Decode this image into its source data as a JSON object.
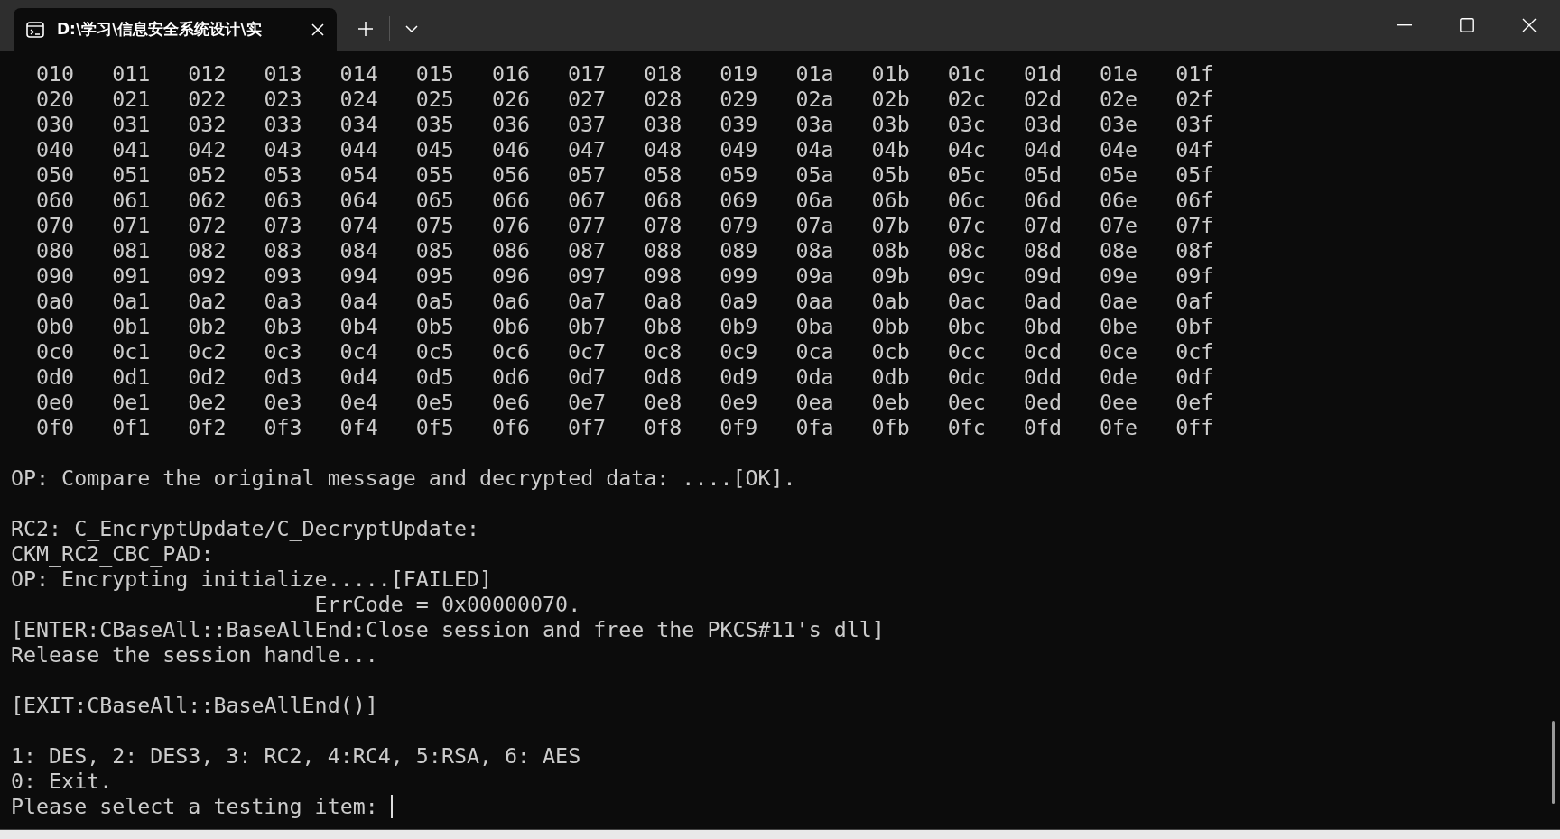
{
  "tab": {
    "title": "D:\\学习\\信息安全系统设计\\实"
  },
  "terminal": {
    "lines": [
      {
        "kind": "hex",
        "cells": [
          "010",
          "011",
          "012",
          "013",
          "014",
          "015",
          "016",
          "017",
          "018",
          "019",
          "01a",
          "01b",
          "01c",
          "01d",
          "01e",
          "01f"
        ]
      },
      {
        "kind": "hex",
        "cells": [
          "020",
          "021",
          "022",
          "023",
          "024",
          "025",
          "026",
          "027",
          "028",
          "029",
          "02a",
          "02b",
          "02c",
          "02d",
          "02e",
          "02f"
        ]
      },
      {
        "kind": "hex",
        "cells": [
          "030",
          "031",
          "032",
          "033",
          "034",
          "035",
          "036",
          "037",
          "038",
          "039",
          "03a",
          "03b",
          "03c",
          "03d",
          "03e",
          "03f"
        ]
      },
      {
        "kind": "hex",
        "cells": [
          "040",
          "041",
          "042",
          "043",
          "044",
          "045",
          "046",
          "047",
          "048",
          "049",
          "04a",
          "04b",
          "04c",
          "04d",
          "04e",
          "04f"
        ]
      },
      {
        "kind": "hex",
        "cells": [
          "050",
          "051",
          "052",
          "053",
          "054",
          "055",
          "056",
          "057",
          "058",
          "059",
          "05a",
          "05b",
          "05c",
          "05d",
          "05e",
          "05f"
        ]
      },
      {
        "kind": "hex",
        "cells": [
          "060",
          "061",
          "062",
          "063",
          "064",
          "065",
          "066",
          "067",
          "068",
          "069",
          "06a",
          "06b",
          "06c",
          "06d",
          "06e",
          "06f"
        ]
      },
      {
        "kind": "hex",
        "cells": [
          "070",
          "071",
          "072",
          "073",
          "074",
          "075",
          "076",
          "077",
          "078",
          "079",
          "07a",
          "07b",
          "07c",
          "07d",
          "07e",
          "07f"
        ]
      },
      {
        "kind": "hex",
        "cells": [
          "080",
          "081",
          "082",
          "083",
          "084",
          "085",
          "086",
          "087",
          "088",
          "089",
          "08a",
          "08b",
          "08c",
          "08d",
          "08e",
          "08f"
        ]
      },
      {
        "kind": "hex",
        "cells": [
          "090",
          "091",
          "092",
          "093",
          "094",
          "095",
          "096",
          "097",
          "098",
          "099",
          "09a",
          "09b",
          "09c",
          "09d",
          "09e",
          "09f"
        ]
      },
      {
        "kind": "hex",
        "cells": [
          "0a0",
          "0a1",
          "0a2",
          "0a3",
          "0a4",
          "0a5",
          "0a6",
          "0a7",
          "0a8",
          "0a9",
          "0aa",
          "0ab",
          "0ac",
          "0ad",
          "0ae",
          "0af"
        ]
      },
      {
        "kind": "hex",
        "cells": [
          "0b0",
          "0b1",
          "0b2",
          "0b3",
          "0b4",
          "0b5",
          "0b6",
          "0b7",
          "0b8",
          "0b9",
          "0ba",
          "0bb",
          "0bc",
          "0bd",
          "0be",
          "0bf"
        ]
      },
      {
        "kind": "hex",
        "cells": [
          "0c0",
          "0c1",
          "0c2",
          "0c3",
          "0c4",
          "0c5",
          "0c6",
          "0c7",
          "0c8",
          "0c9",
          "0ca",
          "0cb",
          "0cc",
          "0cd",
          "0ce",
          "0cf"
        ]
      },
      {
        "kind": "hex",
        "cells": [
          "0d0",
          "0d1",
          "0d2",
          "0d3",
          "0d4",
          "0d5",
          "0d6",
          "0d7",
          "0d8",
          "0d9",
          "0da",
          "0db",
          "0dc",
          "0dd",
          "0de",
          "0df"
        ]
      },
      {
        "kind": "hex",
        "cells": [
          "0e0",
          "0e1",
          "0e2",
          "0e3",
          "0e4",
          "0e5",
          "0e6",
          "0e7",
          "0e8",
          "0e9",
          "0ea",
          "0eb",
          "0ec",
          "0ed",
          "0ee",
          "0ef"
        ]
      },
      {
        "kind": "hex",
        "cells": [
          "0f0",
          "0f1",
          "0f2",
          "0f3",
          "0f4",
          "0f5",
          "0f6",
          "0f7",
          "0f8",
          "0f9",
          "0fa",
          "0fb",
          "0fc",
          "0fd",
          "0fe",
          "0ff"
        ]
      },
      {
        "kind": "blank"
      },
      {
        "kind": "text",
        "text": "OP: Compare the original message and decrypted data: ....[OK]."
      },
      {
        "kind": "blank"
      },
      {
        "kind": "text",
        "text": "RC2: C_EncryptUpdate/C_DecryptUpdate:"
      },
      {
        "kind": "text",
        "text": "CKM_RC2_CBC_PAD:"
      },
      {
        "kind": "text",
        "text": "OP: Encrypting initialize.....[FAILED]"
      },
      {
        "kind": "text",
        "text": "                        ErrCode = 0x00000070."
      },
      {
        "kind": "text",
        "text": "[ENTER:CBaseAll::BaseAllEnd:Close session and free the PKCS#11's dll]"
      },
      {
        "kind": "text",
        "text": "Release the session handle..."
      },
      {
        "kind": "blank"
      },
      {
        "kind": "text",
        "text": "[EXIT:CBaseAll::BaseAllEnd()]"
      },
      {
        "kind": "blank"
      },
      {
        "kind": "text",
        "text": "1: DES, 2: DES3, 3: RC2, 4:RC4, 5:RSA, 6: AES"
      },
      {
        "kind": "text",
        "text": "0: Exit."
      },
      {
        "kind": "prompt",
        "text": "Please select a testing item: "
      }
    ]
  }
}
